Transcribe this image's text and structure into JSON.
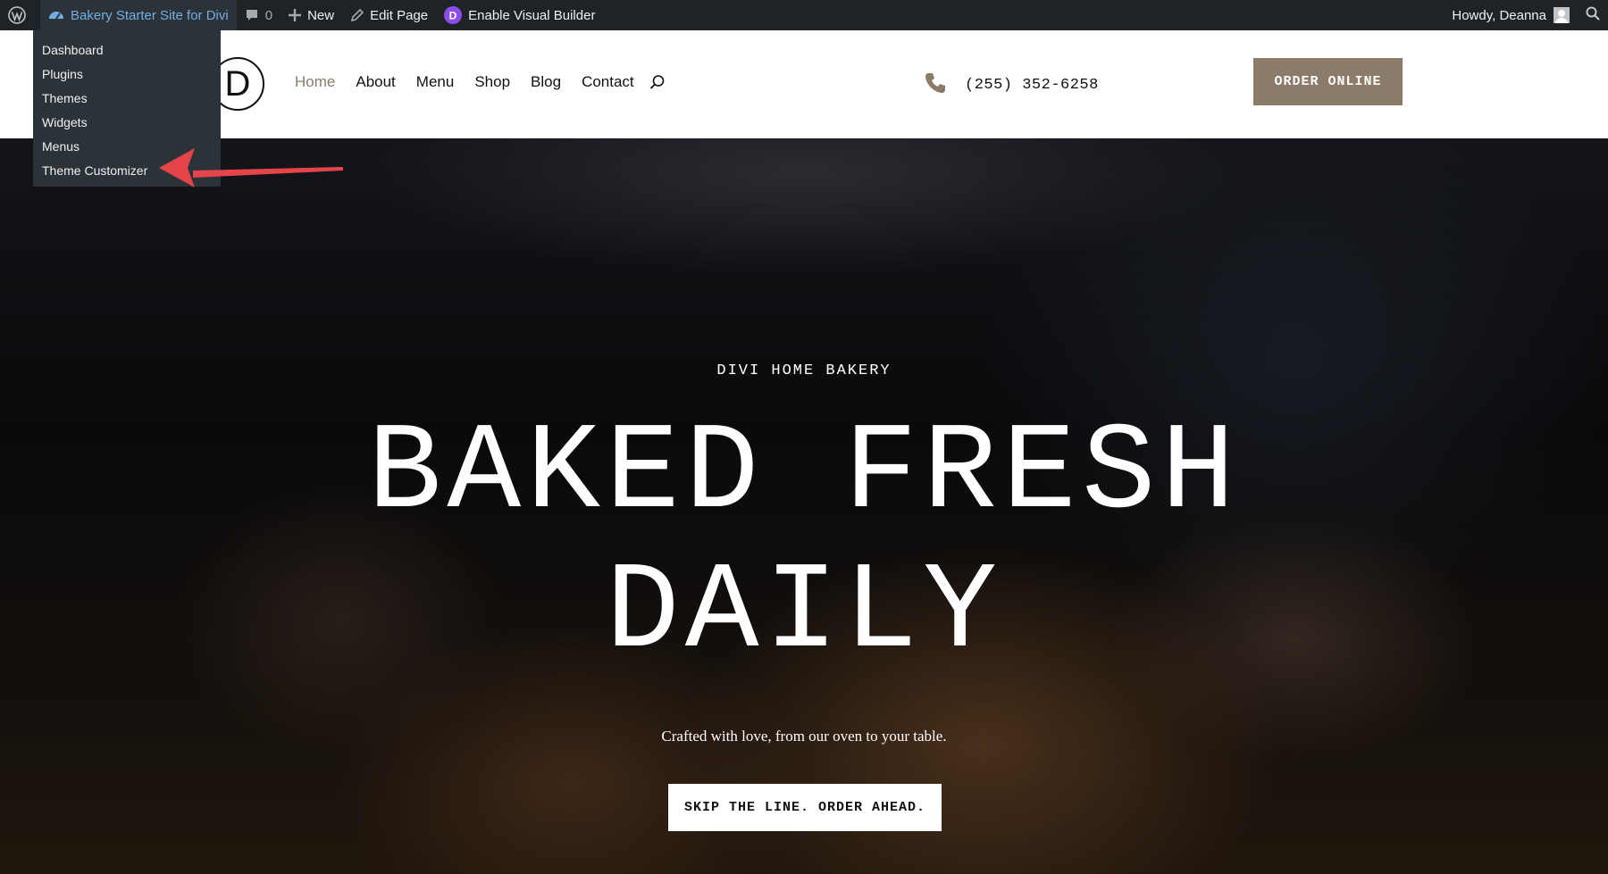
{
  "admin_bar": {
    "site_name": "Bakery Starter Site for Divi",
    "comments_count": "0",
    "new_label": "New",
    "edit_page_label": "Edit Page",
    "visual_builder_label": "Enable Visual Builder",
    "greeting": "Howdy, Deanna",
    "icons": [
      "wordpress-icon",
      "dashboard-icon",
      "comment-icon",
      "plus-icon",
      "pencil-icon",
      "divi-icon",
      "avatar",
      "search-icon"
    ]
  },
  "site_menu": {
    "items": [
      "Dashboard",
      "Plugins",
      "Themes",
      "Widgets",
      "Menus",
      "Theme Customizer"
    ]
  },
  "header": {
    "logo_letter": "D",
    "nav": [
      "Home",
      "About",
      "Menu",
      "Shop",
      "Blog",
      "Contact"
    ],
    "active_nav": "Home",
    "phone": "(255) 352-6258",
    "order_button": "ORDER ONLINE"
  },
  "hero": {
    "eyebrow": "DIVI HOME BAKERY",
    "headline_line1": "BAKED FRESH",
    "headline_line2": "DAILY",
    "tagline": "Crafted with love, from our oven to your table.",
    "cta": "SKIP THE LINE. ORDER AHEAD."
  },
  "colors": {
    "admin_bar_bg": "#1d2327",
    "submenu_bg": "#2c3338",
    "site_link": "#72aee6",
    "accent_brown": "#8c7b69",
    "annotation_red": "#e5454a",
    "divi_purple": "#8d4ce9"
  }
}
